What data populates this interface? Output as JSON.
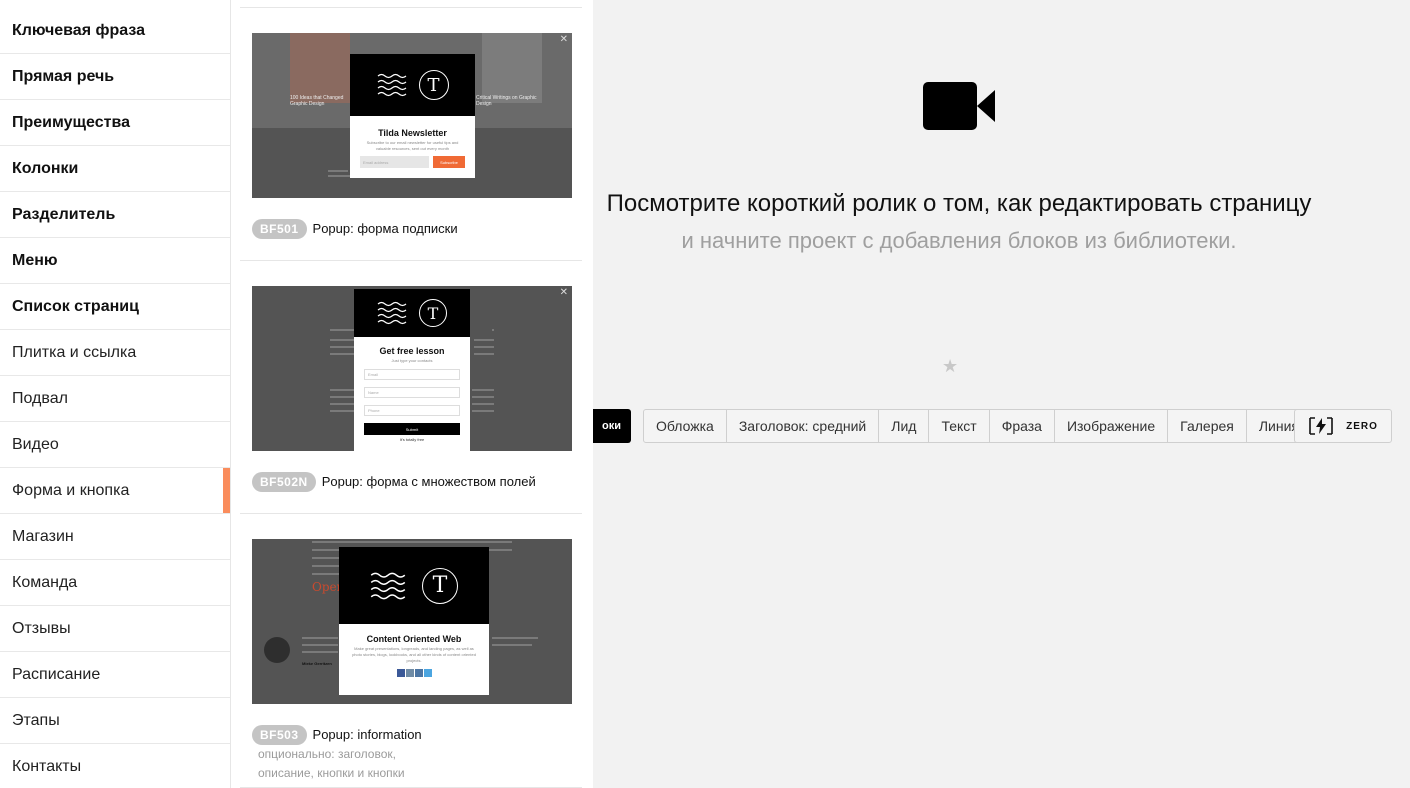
{
  "sidebar": {
    "items": [
      {
        "label": "Ключевая фраза"
      },
      {
        "label": "Прямая речь"
      },
      {
        "label": "Преимущества"
      },
      {
        "label": "Колонки"
      },
      {
        "label": "Разделитель"
      },
      {
        "label": "Меню"
      },
      {
        "label": "Список страниц"
      },
      {
        "label": "Плитка и ссылка"
      },
      {
        "label": "Подвал"
      },
      {
        "label": "Видео"
      },
      {
        "label": "Форма и кнопка"
      },
      {
        "label": "Магазин"
      },
      {
        "label": "Команда"
      },
      {
        "label": "Отзывы"
      },
      {
        "label": "Расписание"
      },
      {
        "label": "Этапы"
      },
      {
        "label": "Контакты"
      }
    ],
    "active_label": "Форма и кнопка",
    "accent_color": "#fa8c5c"
  },
  "blocks": [
    {
      "code": "BF501",
      "name": "Popup: форма подписки",
      "desc": "",
      "preview": {
        "title": "Tilda Newsletter",
        "subtitle": "Subscribe to our email newsletter for useful tips and valuable resources, sent out every month",
        "input_placeholder": "Email address",
        "button": "Subscribe",
        "bg_left_caption": "100 Ideas that Changed Graphic Design",
        "bg_right_caption": "Critical Writings on Graphic Design"
      }
    },
    {
      "code": "BF502N",
      "name": "Popup: форма с множеством полей",
      "desc": "",
      "preview": {
        "title": "Get free lesson",
        "subtitle": "Just type your contacts",
        "fields": [
          "Email",
          "Name",
          "Phone"
        ],
        "button": "Submit",
        "footnote": "It's totally free"
      }
    },
    {
      "code": "BF503",
      "name": "Popup: information",
      "desc": "опционально: заголовок, описание, кнопки и кнопки «поделиться»",
      "preview": {
        "title": "Content Oriented Web",
        "subtitle": "Make great presentations, longreads, and landing pages, as well as photo stories, blogs, lookbooks, and all other kinds of content oriented projects.",
        "bg_heading": "Open",
        "bg_author": "Mieke Gerritzen"
      }
    }
  ],
  "main": {
    "headline": "Посмотрите короткий ролик о том, как редактировать страницу",
    "subline": "и начните проект с добавления блоков из библиотеки.",
    "all_blocks_btn": "оки",
    "tags": [
      "Обложка",
      "Заголовок: средний",
      "Лид",
      "Текст",
      "Фраза",
      "Изображение",
      "Галерея",
      "Линия"
    ],
    "zero_label": "ZERO"
  }
}
